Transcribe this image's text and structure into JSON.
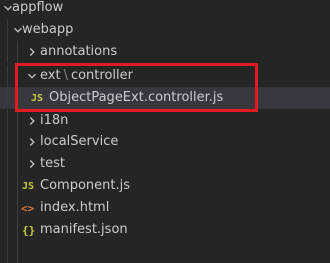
{
  "explorer": {
    "items": [
      {
        "label": "appflow"
      },
      {
        "label": "webapp"
      },
      {
        "label": "annotations"
      },
      {
        "label_a": "ext",
        "separator": "\\",
        "label_b": "controller"
      },
      {
        "icon_text": "JS",
        "label": "ObjectPageExt.controller.js"
      },
      {
        "label": "i18n"
      },
      {
        "label": "localService"
      },
      {
        "label": "test"
      },
      {
        "icon_text": "JS",
        "label": "Component.js"
      },
      {
        "icon_text": "<>",
        "label": "index.html"
      },
      {
        "icon_text": "{}",
        "label": "manifest.json"
      }
    ]
  },
  "icons": {
    "chevron_down": "chevron-down-icon",
    "chevron_right": "chevron-right-icon",
    "js_file": "js-file-icon",
    "html_file": "html-file-icon",
    "json_file": "json-file-icon"
  },
  "colors": {
    "background": "#252526",
    "text": "#cccccc",
    "selected_row": "#37373d",
    "highlight_box": "#e21b23",
    "js_icon": "#cbcb41",
    "html_icon": "#e37933",
    "indent_guide": "#3c3c3c"
  }
}
